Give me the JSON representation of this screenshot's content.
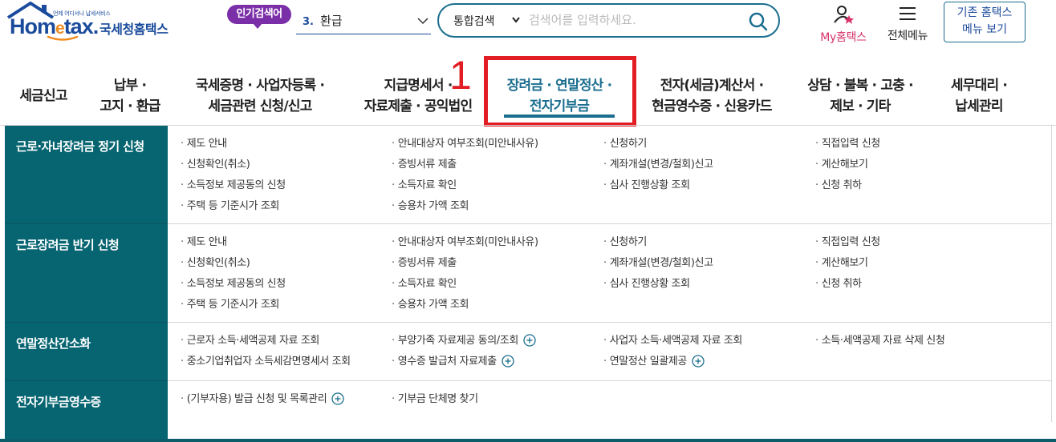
{
  "header": {
    "logo": {
      "tagline": "언제 어디서나 납세서비스",
      "brand_en_pre": "Hom",
      "brand_en_e": "e",
      "brand_en_post": "tax.",
      "brand_ko": "국세청홈택스"
    },
    "popular": {
      "badge": "인기검색어",
      "rank": "3.",
      "keyword": "환급"
    },
    "search": {
      "scope": "통합검색",
      "placeholder": "검색어를 입력하세요."
    },
    "my_hometax_label": "My홈택스",
    "all_menu_label": "전체메뉴",
    "old_menu_line1": "기존 홈택스",
    "old_menu_line2": "메뉴 보기"
  },
  "gnb": {
    "items": [
      {
        "label": "세금신고"
      },
      {
        "label": "납부 ·\n고지 · 환급"
      },
      {
        "label": "국세증명 · 사업자등록 ·\n세금관련 신청/신고"
      },
      {
        "label": "지급명세서 ·\n자료제출 · 공익법인"
      },
      {
        "label": "장려금 · 연말정산 ·\n전자기부금"
      },
      {
        "label": "전자(세금)계산서 ·\n현금영수증 · 신용카드"
      },
      {
        "label": "상담 · 불복 · 고충 ·\n제보 · 기타"
      },
      {
        "label": "세무대리 ·\n납세관리"
      }
    ],
    "active_index": 4,
    "annotation_number": "1"
  },
  "mega": {
    "groups": [
      {
        "title": "근로·자녀장려금 정기 신청",
        "links": [
          "제도 안내",
          "안내대상자 여부조회(미안내사유)",
          "신청하기",
          "직접입력 신청",
          "신청확인(취소)",
          "증빙서류 제출",
          "계좌개설(변경/철회)신고",
          "계산해보기",
          "소득정보 제공동의 신청",
          "소득자료 확인",
          "심사 진행상황 조회",
          "신청 취하",
          "주택 등 기준시가 조회",
          "승용차 가액 조회"
        ]
      },
      {
        "title": "근로장려금 반기 신청",
        "links": [
          "제도 안내",
          "안내대상자 여부조회(미안내사유)",
          "신청하기",
          "직접입력 신청",
          "신청확인(취소)",
          "증빙서류 제출",
          "계좌개설(변경/철회)신고",
          "계산해보기",
          "소득정보 제공동의 신청",
          "소득자료 확인",
          "심사 진행상황 조회",
          "신청 취하",
          "주택 등 기준시가 조회",
          "승용차 가액 조회"
        ]
      },
      {
        "title": "연말정산간소화",
        "links": [
          "근로자 소득·세액공제 자료 조회",
          "부양가족 자료제공 동의/조회",
          "사업자 소득·세액공제 자료 조회",
          "소득·세액공제 자료 삭제 신청",
          "중소기업취업자 소득세감면명세서 조회",
          "영수증 발급처 자료제출",
          "연말정산 일괄제공"
        ],
        "expandable": [
          false,
          true,
          false,
          false,
          false,
          true,
          true
        ]
      },
      {
        "title": "전자기부금영수증",
        "links": [
          "(기부자용) 발급 신청 및 목록관리",
          "기부금 단체명 찾기"
        ],
        "expandable": [
          true,
          false
        ]
      }
    ]
  },
  "colors": {
    "brand_blue": "#1b4b9c",
    "teal": "#066571",
    "accent_pink": "#d6326b",
    "badge_purple": "#7a2ea7",
    "annotation_red": "#e21d24"
  },
  "icons": [
    "home-roof-icon",
    "chevron-down-icon",
    "search-icon",
    "my-hometax-icon",
    "hamburger-menu-icon",
    "plus-circle-icon"
  ]
}
